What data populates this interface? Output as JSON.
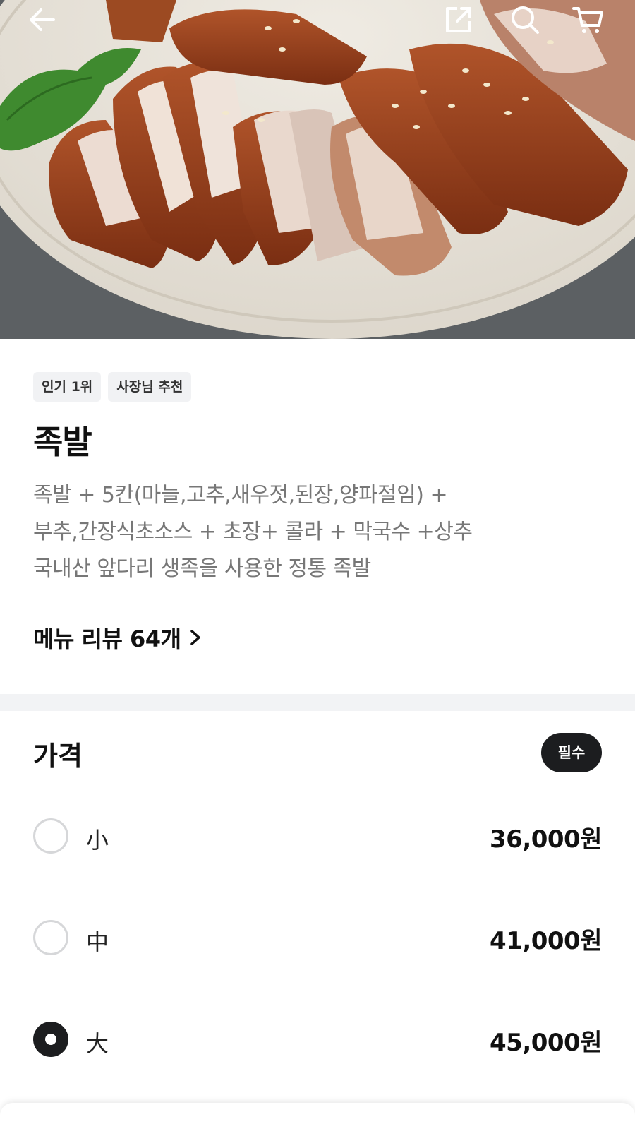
{
  "header": {
    "back_icon": "arrow-left-icon",
    "share_icon": "share-icon",
    "search_icon": "search-icon",
    "cart_icon": "cart-icon"
  },
  "menu": {
    "tags": [
      "인기 1위",
      "사장님 추천"
    ],
    "name": "족발",
    "description_lines": [
      "족발 + 5칸(마늘,고추,새우젓,된장,양파절임) +",
      "부추,간장식초소스 + 초장+ 콜라 + 막국수 +상추",
      "국내산 앞다리 생족을 사용한 정통 족발"
    ],
    "review_link": "메뉴 리뷰 64개"
  },
  "price_section": {
    "title": "가격",
    "required_badge": "필수",
    "options": [
      {
        "label": "小",
        "price": "36,000원",
        "selected": false
      },
      {
        "label": "中",
        "price": "41,000원",
        "selected": false
      },
      {
        "label": "大",
        "price": "45,000원",
        "selected": true
      }
    ]
  },
  "colors": {
    "text_primary": "#111111",
    "text_secondary": "#777777",
    "badge_bg": "#1c1d1f",
    "tag_bg": "#f1f2f4",
    "divider": "#f2f3f5"
  }
}
